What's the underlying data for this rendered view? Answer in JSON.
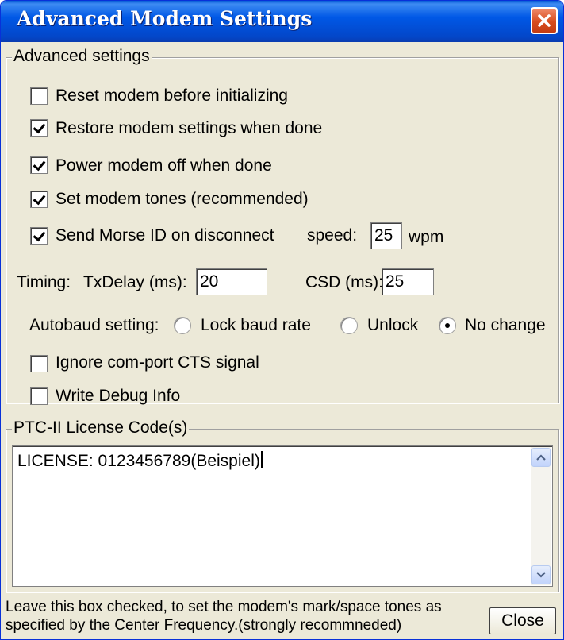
{
  "window": {
    "title": "Advanced Modem Settings"
  },
  "advanced": {
    "legend": "Advanced settings",
    "options": [
      {
        "label": "Reset modem before initializing",
        "checked": false
      },
      {
        "label": "Restore modem settings when done",
        "checked": true
      },
      {
        "label": "Power modem off when done",
        "checked": true
      },
      {
        "label": "Set modem tones (recommended)",
        "checked": true
      },
      {
        "label": "Send Morse ID on disconnect",
        "checked": true
      }
    ],
    "speed_label": "speed:",
    "speed_value": "25",
    "speed_unit": "wpm",
    "timing_label": "Timing:",
    "txdelay_label": "TxDelay (ms):",
    "txdelay_value": "20",
    "csd_label": "CSD (ms):",
    "csd_value": "25",
    "autobaud_label": "Autobaud setting:",
    "autobaud_options": [
      {
        "label": "Lock baud rate",
        "selected": false
      },
      {
        "label": "Unlock",
        "selected": false
      },
      {
        "label": "No change",
        "selected": true
      }
    ],
    "ignore_cts": {
      "label": "Ignore com-port CTS signal",
      "checked": false
    },
    "write_debug": {
      "label": "Write Debug Info",
      "checked": false
    }
  },
  "license": {
    "legend": "PTC-II License Code(s)",
    "value": "LICENSE: 0123456789(Beispiel)"
  },
  "help_text": "Leave this box checked, to set the modem's mark/space tones as specified by the Center Frequency.(strongly recommneded)",
  "close_label": "Close",
  "icons": {
    "title_close": "close-icon",
    "scroll_up": "arrow-up-icon",
    "scroll_down": "arrow-down-icon"
  },
  "colors": {
    "titlebar": "#0058e6",
    "window_bg": "#ece9d8",
    "close_button": "#d84c1e"
  }
}
